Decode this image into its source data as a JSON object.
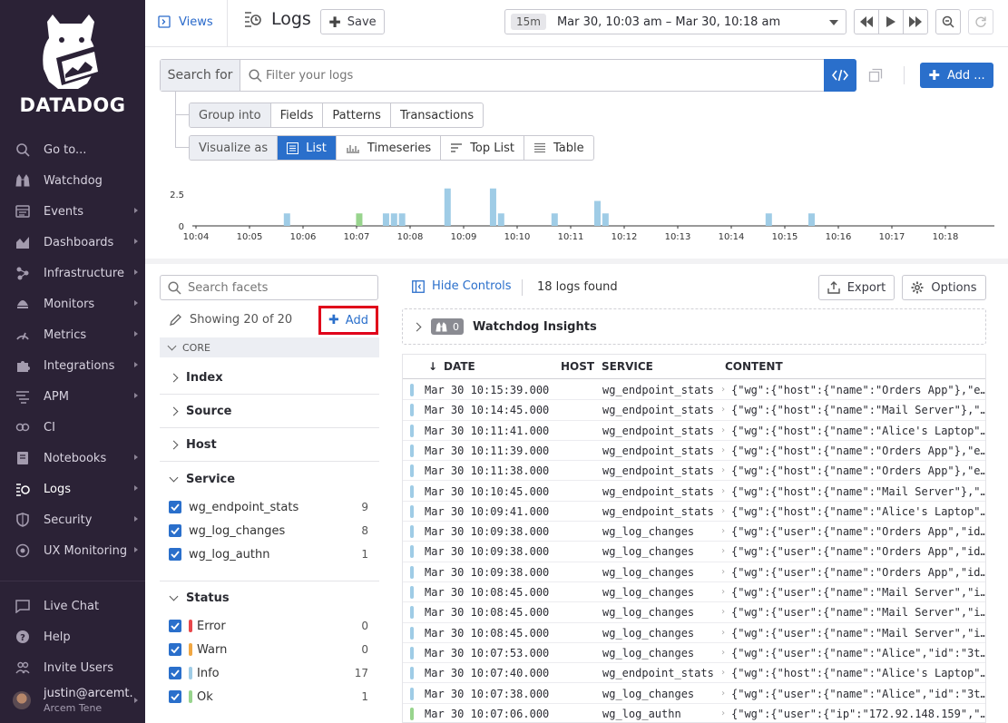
{
  "sidebar": {
    "brand": "DATADOG",
    "items": [
      {
        "label": "Go to...",
        "icon": "search-icon",
        "arrow": false
      },
      {
        "label": "Watchdog",
        "icon": "binoculars-icon",
        "arrow": false
      },
      {
        "label": "Events",
        "icon": "events-icon",
        "arrow": true
      },
      {
        "label": "Dashboards",
        "icon": "dashboard-icon",
        "arrow": true
      },
      {
        "label": "Infrastructure",
        "icon": "infrastructure-icon",
        "arrow": true
      },
      {
        "label": "Monitors",
        "icon": "monitors-icon",
        "arrow": true
      },
      {
        "label": "Metrics",
        "icon": "metrics-icon",
        "arrow": true
      },
      {
        "label": "Integrations",
        "icon": "puzzle-icon",
        "arrow": true
      },
      {
        "label": "APM",
        "icon": "apm-icon",
        "arrow": true
      },
      {
        "label": "CI",
        "icon": "ci-icon",
        "arrow": false
      },
      {
        "label": "Notebooks",
        "icon": "notebook-icon",
        "arrow": true
      },
      {
        "label": "Logs",
        "icon": "logs-icon",
        "arrow": true,
        "active": true
      },
      {
        "label": "Security",
        "icon": "shield-icon",
        "arrow": true
      },
      {
        "label": "UX Monitoring",
        "icon": "ux-icon",
        "arrow": true
      }
    ],
    "footer": [
      {
        "label": "Live Chat",
        "icon": "chat-icon"
      },
      {
        "label": "Help",
        "icon": "help-icon"
      },
      {
        "label": "Invite Users",
        "icon": "users-icon"
      }
    ],
    "user": {
      "name": "justin@arcemt...",
      "org": "Arcem Tene"
    }
  },
  "topbar": {
    "views": "Views",
    "title": "Logs",
    "save": "Save",
    "time_badge": "15m",
    "time_range": "Mar 30, 10:03 am – Mar 30, 10:18 am"
  },
  "search": {
    "label": "Search for",
    "placeholder": "Filter your logs",
    "add": "Add ..."
  },
  "group_into": {
    "label": "Group into",
    "options": [
      "Fields",
      "Patterns",
      "Transactions"
    ]
  },
  "visualize_as": {
    "label": "Visualize as",
    "options": [
      "List",
      "Timeseries",
      "Top List",
      "Table"
    ],
    "selected": "List"
  },
  "chart_data": {
    "type": "bar",
    "y_ticks": [
      "2.5",
      "0"
    ],
    "x_ticks": [
      "10:04",
      "10:05",
      "10:06",
      "10:07",
      "10:08",
      "10:09",
      "10:10",
      "10:11",
      "10:12",
      "10:13",
      "10:14",
      "10:15",
      "10:16",
      "10:17",
      "10:18"
    ],
    "bars": [
      {
        "t": 1.7,
        "value": 1,
        "status": "info"
      },
      {
        "t": 3.05,
        "value": 1,
        "status": "ok"
      },
      {
        "t": 3.55,
        "value": 1,
        "status": "info"
      },
      {
        "t": 3.7,
        "value": 1,
        "status": "info"
      },
      {
        "t": 3.85,
        "value": 1,
        "status": "info"
      },
      {
        "t": 4.7,
        "value": 3,
        "status": "info"
      },
      {
        "t": 5.55,
        "value": 3,
        "status": "info"
      },
      {
        "t": 5.7,
        "value": 1,
        "status": "info"
      },
      {
        "t": 6.7,
        "value": 1,
        "status": "info"
      },
      {
        "t": 7.5,
        "value": 2,
        "status": "info"
      },
      {
        "t": 7.65,
        "value": 1,
        "status": "info"
      },
      {
        "t": 10.7,
        "value": 1,
        "status": "info"
      },
      {
        "t": 11.5,
        "value": 1,
        "status": "info"
      }
    ],
    "ylim": [
      0,
      3.2
    ],
    "colors": {
      "info": "#9fcce6",
      "ok": "#98d48d"
    }
  },
  "facets": {
    "search_placeholder": "Search facets",
    "showing": "Showing 20 of 20",
    "add": "Add",
    "core": "CORE",
    "groups": [
      "Index",
      "Source",
      "Host",
      "Service",
      "Status"
    ],
    "service_items": [
      {
        "label": "wg_endpoint_stats",
        "count": "9"
      },
      {
        "label": "wg_log_changes",
        "count": "8"
      },
      {
        "label": "wg_log_authn",
        "count": "1"
      }
    ],
    "status_items": [
      {
        "label": "Error",
        "count": "0",
        "color": "#e8474b"
      },
      {
        "label": "Warn",
        "count": "0",
        "color": "#f1a742"
      },
      {
        "label": "Info",
        "count": "17",
        "color": "#9fcce6"
      },
      {
        "label": "Ok",
        "count": "1",
        "color": "#98d48d"
      }
    ]
  },
  "logs": {
    "hide_controls": "Hide Controls",
    "found": "18 logs found",
    "export": "Export",
    "options": "Options",
    "watchdog": "Watchdog Insights",
    "watchdog_count": "0",
    "columns": [
      "DATE",
      "HOST",
      "SERVICE",
      "CONTENT"
    ],
    "rows": [
      {
        "date": "Mar 30 10:15:39.000",
        "service": "wg_endpoint_stats",
        "content": "{\"wg\":{\"host\":{\"name\":\"Orders App\"},\"e…",
        "color": "#9fcce6"
      },
      {
        "date": "Mar 30 10:14:45.000",
        "service": "wg_endpoint_stats",
        "content": "{\"wg\":{\"host\":{\"name\":\"Mail Server\"},\"…",
        "color": "#9fcce6"
      },
      {
        "date": "Mar 30 10:11:41.000",
        "service": "wg_endpoint_stats",
        "content": "{\"wg\":{\"host\":{\"name\":\"Alice's Laptop\"…",
        "color": "#9fcce6"
      },
      {
        "date": "Mar 30 10:11:39.000",
        "service": "wg_endpoint_stats",
        "content": "{\"wg\":{\"host\":{\"name\":\"Orders App\"},\"e…",
        "color": "#9fcce6"
      },
      {
        "date": "Mar 30 10:11:38.000",
        "service": "wg_endpoint_stats",
        "content": "{\"wg\":{\"host\":{\"name\":\"Orders App\"},\"e…",
        "color": "#9fcce6"
      },
      {
        "date": "Mar 30 10:10:45.000",
        "service": "wg_endpoint_stats",
        "content": "{\"wg\":{\"host\":{\"name\":\"Mail Server\"},\"…",
        "color": "#9fcce6"
      },
      {
        "date": "Mar 30 10:09:41.000",
        "service": "wg_endpoint_stats",
        "content": "{\"wg\":{\"host\":{\"name\":\"Alice's Laptop\"…",
        "color": "#9fcce6"
      },
      {
        "date": "Mar 30 10:09:38.000",
        "service": "wg_log_changes",
        "content": "{\"wg\":{\"user\":{\"name\":\"Orders App\",\"id…",
        "color": "#9fcce6"
      },
      {
        "date": "Mar 30 10:09:38.000",
        "service": "wg_log_changes",
        "content": "{\"wg\":{\"user\":{\"name\":\"Orders App\",\"id…",
        "color": "#9fcce6"
      },
      {
        "date": "Mar 30 10:09:38.000",
        "service": "wg_log_changes",
        "content": "{\"wg\":{\"user\":{\"name\":\"Orders App\",\"id…",
        "color": "#9fcce6"
      },
      {
        "date": "Mar 30 10:08:45.000",
        "service": "wg_log_changes",
        "content": "{\"wg\":{\"user\":{\"name\":\"Mail Server\",\"i…",
        "color": "#9fcce6"
      },
      {
        "date": "Mar 30 10:08:45.000",
        "service": "wg_log_changes",
        "content": "{\"wg\":{\"user\":{\"name\":\"Mail Server\",\"i…",
        "color": "#9fcce6"
      },
      {
        "date": "Mar 30 10:08:45.000",
        "service": "wg_log_changes",
        "content": "{\"wg\":{\"user\":{\"name\":\"Mail Server\",\"i…",
        "color": "#9fcce6"
      },
      {
        "date": "Mar 30 10:07:53.000",
        "service": "wg_log_changes",
        "content": "{\"wg\":{\"user\":{\"name\":\"Alice\",\"id\":\"3t…",
        "color": "#9fcce6"
      },
      {
        "date": "Mar 30 10:07:40.000",
        "service": "wg_endpoint_stats",
        "content": "{\"wg\":{\"host\":{\"name\":\"Alice's Laptop\"…",
        "color": "#9fcce6"
      },
      {
        "date": "Mar 30 10:07:38.000",
        "service": "wg_log_changes",
        "content": "{\"wg\":{\"user\":{\"name\":\"Alice\",\"id\":\"3t…",
        "color": "#9fcce6"
      },
      {
        "date": "Mar 30 10:07:06.000",
        "service": "wg_log_authn",
        "content": "{\"wg\":{\"user\":{\"ip\":\"172.92.148.159\",\"…",
        "color": "#98d48d"
      }
    ]
  }
}
